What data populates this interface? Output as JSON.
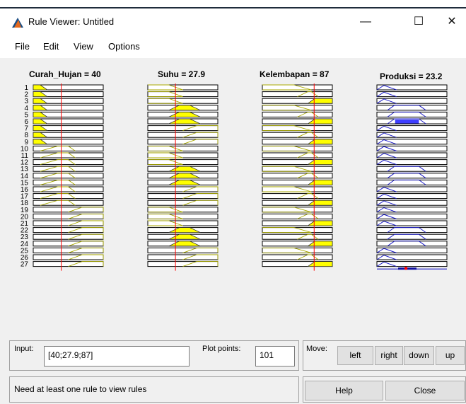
{
  "window": {
    "title": "Rule Viewer: Untitled",
    "minimize_glyph": "—",
    "maximize_glyph": "☐",
    "close_glyph": "✕"
  },
  "menu": [
    "File",
    "Edit",
    "View",
    "Options"
  ],
  "variables": {
    "inputs": [
      {
        "label": "Curah_Hujan = 40",
        "value": 40,
        "range": [
          0,
          100
        ],
        "mf_count": 3
      },
      {
        "label": "Suhu = 27.9",
        "value": 27.9,
        "range": [
          20,
          40
        ],
        "mf_count": 3
      },
      {
        "label": "Kelembapan = 87",
        "value": 87,
        "range": [
          50,
          100
        ],
        "mf_count": 3
      }
    ],
    "output": {
      "label": "Produksi = 23.2",
      "value": 23.2,
      "mf_count": 3
    }
  },
  "rules": {
    "numbers": [
      "1",
      "2",
      "3",
      "4",
      "5",
      "6",
      "7",
      "8",
      "9",
      "10",
      "11",
      "12",
      "13",
      "14",
      "15",
      "16",
      "17",
      "18",
      "19",
      "20",
      "21",
      "22",
      "23",
      "24",
      "25",
      "26",
      "27"
    ],
    "antecedents": [
      [
        1,
        1,
        1
      ],
      [
        1,
        1,
        2
      ],
      [
        1,
        1,
        3
      ],
      [
        1,
        2,
        1
      ],
      [
        1,
        2,
        2
      ],
      [
        1,
        2,
        3
      ],
      [
        1,
        3,
        1
      ],
      [
        1,
        3,
        2
      ],
      [
        1,
        3,
        3
      ],
      [
        2,
        1,
        1
      ],
      [
        2,
        1,
        2
      ],
      [
        2,
        1,
        3
      ],
      [
        2,
        2,
        1
      ],
      [
        2,
        2,
        2
      ],
      [
        2,
        2,
        3
      ],
      [
        2,
        3,
        1
      ],
      [
        2,
        3,
        2
      ],
      [
        2,
        3,
        3
      ],
      [
        3,
        1,
        1
      ],
      [
        3,
        1,
        2
      ],
      [
        3,
        1,
        3
      ],
      [
        3,
        2,
        1
      ],
      [
        3,
        2,
        2
      ],
      [
        3,
        2,
        3
      ],
      [
        3,
        3,
        1
      ],
      [
        3,
        3,
        2
      ],
      [
        3,
        3,
        3
      ]
    ],
    "consequents": [
      1,
      1,
      1,
      2,
      2,
      2,
      1,
      1,
      1,
      1,
      1,
      1,
      2,
      2,
      2,
      1,
      1,
      1,
      1,
      1,
      1,
      2,
      2,
      2,
      1,
      1,
      1
    ]
  },
  "controls": {
    "input_label": "Input:",
    "input_value": "[40;27.9;87]",
    "plot_points_label": "Plot points:",
    "plot_points_value": "101",
    "move_label": "Move:",
    "move_buttons": [
      "left",
      "right",
      "down",
      "up"
    ],
    "status_text": "Need at least one rule to view rules",
    "help_label": "Help",
    "close_label": "Close"
  },
  "colors": {
    "input_mf": "#a8a800",
    "output_mf": "#2020c8",
    "fill": "#ffff00",
    "output_fill": "#3f3fff",
    "indicator": "#ff0000"
  },
  "icons": [
    "matlab-logo-icon",
    "minimize-icon",
    "maximize-icon",
    "close-icon"
  ]
}
